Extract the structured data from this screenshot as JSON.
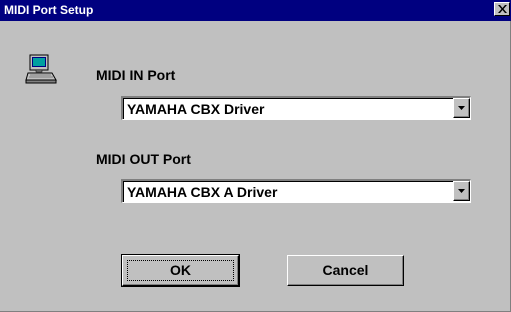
{
  "window": {
    "title": "MIDI Port Setup",
    "close_icon": "close-icon",
    "app_icon": "computer-icon"
  },
  "midi_in": {
    "label": "MIDI IN Port",
    "selected": "YAMAHA CBX Driver"
  },
  "midi_out": {
    "label": "MIDI OUT Port",
    "selected": "YAMAHA CBX A Driver"
  },
  "buttons": {
    "ok": "OK",
    "cancel": "Cancel"
  },
  "colors": {
    "titlebar": "#000080",
    "face": "#c0c0c0"
  }
}
